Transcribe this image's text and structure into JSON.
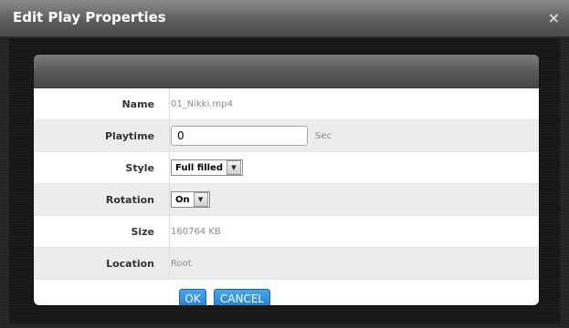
{
  "dialog": {
    "title": "Edit Play Properties",
    "close_glyph": "×"
  },
  "fields": {
    "name": {
      "label": "Name",
      "value": "01_Nikki.mp4"
    },
    "playtime": {
      "label": "Playtime",
      "value": "0",
      "unit": "Sec"
    },
    "style": {
      "label": "Style",
      "selected": "Full filled"
    },
    "rotation": {
      "label": "Rotation",
      "selected": "On"
    },
    "size": {
      "label": "Size",
      "value": "160764 KB"
    },
    "location": {
      "label": "Location",
      "value": "Root"
    }
  },
  "buttons": {
    "ok": "OK",
    "cancel": "CANCEL"
  },
  "colors": {
    "button_blue": "#2a8ad6",
    "title_bar": "#6a6a6a"
  }
}
